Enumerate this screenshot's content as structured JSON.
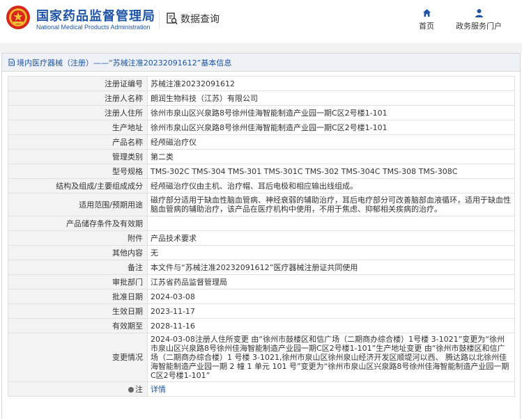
{
  "header": {
    "site_title": "国家药品监督管理局",
    "site_subtitle": "National Medical Products Administration",
    "data_query": "数据查询",
    "nav": {
      "home": "首页",
      "services": "政务服务门户"
    }
  },
  "breadcrumb": "境内医疗器械（注册）——“苏械注准20232091612”基本信息",
  "rows": [
    {
      "label": "注册证编号",
      "value": "苏械注准20232091612"
    },
    {
      "label": "注册人名称",
      "value": "朗润生物科技（江苏）有限公司"
    },
    {
      "label": "注册人住所",
      "value": "徐州市泉山区兴泉路8号徐州佳海智能制造产业园一期C区2号楼1-101"
    },
    {
      "label": "生产地址",
      "value": "徐州市泉山区兴泉路8号徐州佳海智能制造产业园一期C区2号楼1-101"
    },
    {
      "label": "产品名称",
      "value": "经颅磁治疗仪"
    },
    {
      "label": "管理类别",
      "value": "第二类"
    },
    {
      "label": "型号规格",
      "value": "TMS-302C TMS-304 TMS-301 TMS-301C TMS-302 TMS-304C TMS-308 TMS-308C"
    },
    {
      "label": "结构及组成/主要组成成分",
      "value": "经颅磁治疗仪由主机、治疗帽、耳后电极和相应输出线组成。"
    },
    {
      "label": "适用范围/预期用途",
      "value": "磁疗部分适用于缺血性脑血管病、神经衰弱的辅助治疗，耳后电疗部分可改善脑部血液循环，适用于缺血性脑血管病的辅助治疗，该产品在医疗机构中使用，不用于焦虑、抑郁相关疾病的治疗。"
    },
    {
      "label": "产品储存条件及有效期",
      "value": ""
    },
    {
      "label": "附件",
      "value": "产品技术要求"
    },
    {
      "label": "其他内容",
      "value": "无"
    },
    {
      "label": "备注",
      "value": "本文件与“苏械注准20232091612”医疗器械注册证共同使用"
    },
    {
      "label": "审批部门",
      "value": "江苏省药品监督管理局"
    },
    {
      "label": "批准日期",
      "value": "2024-03-08"
    },
    {
      "label": "生效日期",
      "value": "2023-11-17"
    },
    {
      "label": "有效期至",
      "value": "2028-11-16"
    },
    {
      "label": "变更情况",
      "value": "2024-03-08注册人住所变更 由“徐州市鼓楼区和信广场（二期商办综合楼）1号楼 3-1021”变更为“徐州市泉山区兴泉路8号徐州佳海智能制造产业园一期C区2号楼1-101”生产地址变更 由“徐州市鼓楼区和信广场（二期商办综合楼）1 号楼 3-1021,徐州市泉山区徐州泉山经济开发区顺堤河以西、 腾达路以北徐州佳海智能制造产业园一期 2 幢 1 单元 101 号”变更为“徐州市泉山区兴泉路8号徐州佳海智能制造产业园一期C区2号楼1-101”"
    },
    {
      "label": "注",
      "value": "详情"
    }
  ]
}
